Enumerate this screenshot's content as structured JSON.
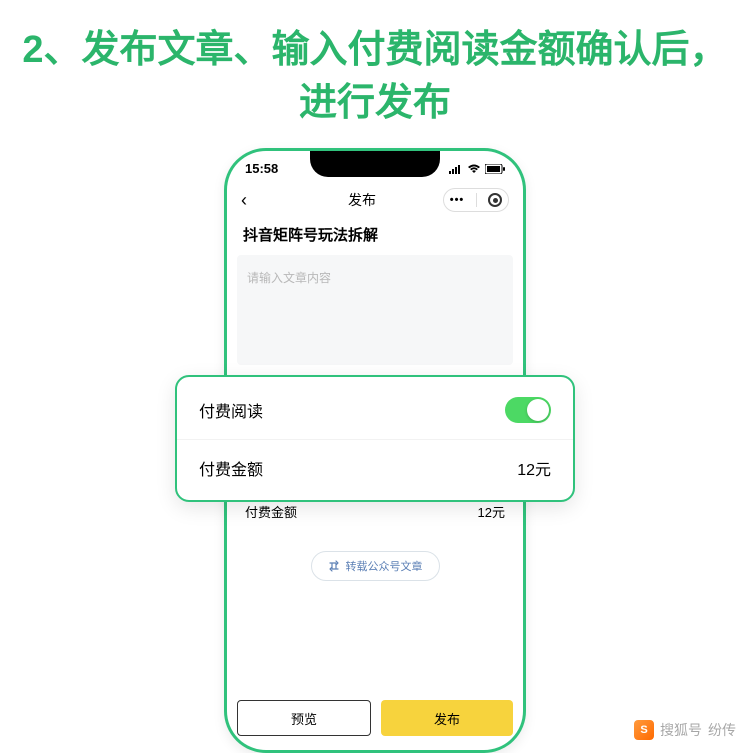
{
  "headline": "2、发布文章、输入付费阅读金额确认后，进行发布",
  "statusbar": {
    "time": "15:58"
  },
  "nav": {
    "back": "‹",
    "title": "发布",
    "dots": "•••"
  },
  "article": {
    "title": "抖音矩阵号玩法拆解",
    "placeholder": "请输入文章内容"
  },
  "settings": {
    "paid_read_label": "付费阅读",
    "paid_amount_label": "付费金额",
    "paid_amount_value": "12元"
  },
  "repost": {
    "label": "转载公众号文章"
  },
  "buttons": {
    "preview": "预览",
    "publish": "发布"
  },
  "highlight": {
    "paid_read_label": "付费阅读",
    "paid_amount_label": "付费金额",
    "paid_amount_value": "12元"
  },
  "watermark": {
    "brand": "搜狐号",
    "author": "纷传",
    "s": "S"
  }
}
